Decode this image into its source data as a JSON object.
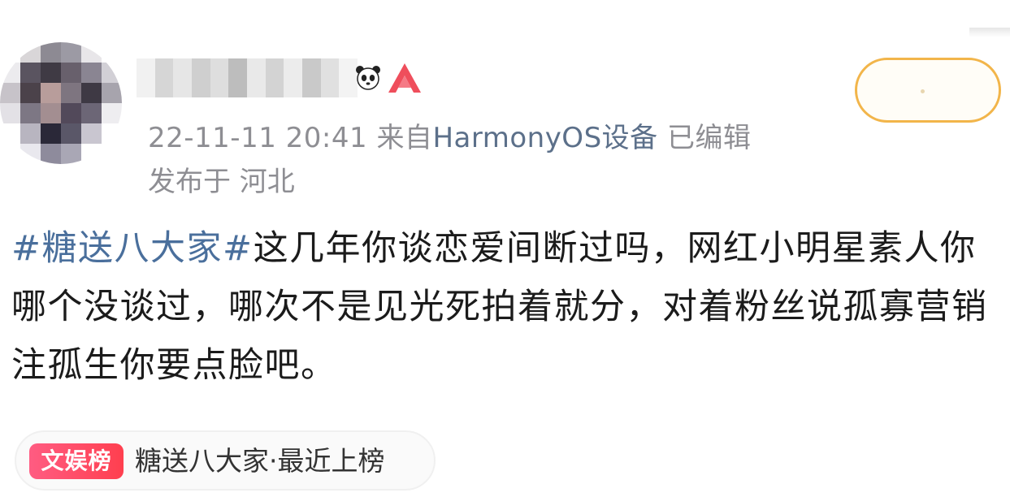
{
  "post": {
    "timestamp": "22-11-11 20:41",
    "source_prefix": "来自",
    "source_device": "HarmonyOS设备",
    "edited": "已编辑",
    "location": "发布于 河北",
    "topic": "#糖送八大家#",
    "body": "这几年你谈恋爱间断过吗，网红小明星素人你哪个没谈过，哪次不是见光死拍着就分，对着粉丝说孤寡营销注孤生你要点脸吧。"
  },
  "trend": {
    "badge": "文娱榜",
    "text": "糖送八大家·最近上榜"
  },
  "icons": {
    "panda": "panda-icon",
    "rank": "rank-badge-icon"
  },
  "colors": {
    "topic_link": "#4a6f9c",
    "follow_border": "#f2b54a",
    "badge_start": "#ff5c82",
    "badge_end": "#ff3f4f"
  }
}
